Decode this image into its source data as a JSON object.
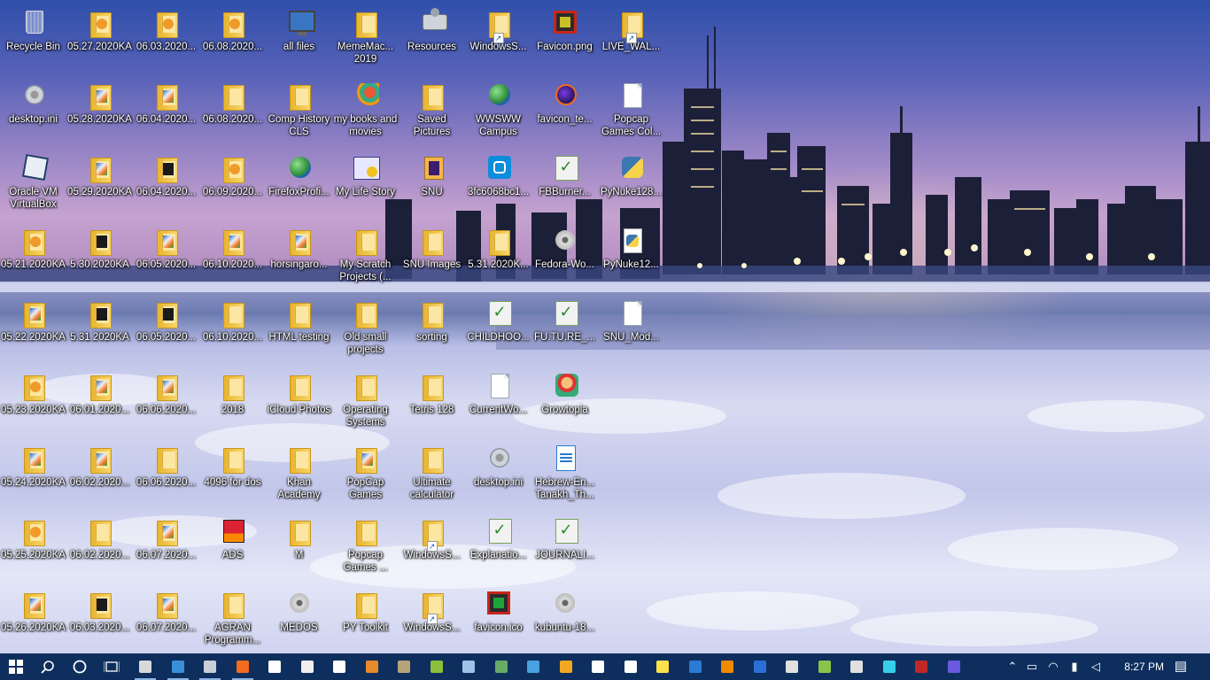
{
  "desktop_icons": [
    {
      "label": "Recycle Bin",
      "icon": "recycle-bin-icon",
      "col": 0,
      "row": 0
    },
    {
      "label": "desktop.ini",
      "icon": "settings-file-icon",
      "col": 0,
      "row": 1
    },
    {
      "label": "Oracle VM VirtualBox",
      "icon": "virtualbox-icon",
      "col": 0,
      "row": 2
    },
    {
      "label": "05.21.2020KA",
      "icon": "orange-folder-icon",
      "col": 0,
      "row": 3
    },
    {
      "label": "05.22.2020KA",
      "icon": "cover-folder-icon",
      "col": 0,
      "row": 4
    },
    {
      "label": "05.23.2020KA",
      "icon": "orange-folder-icon",
      "col": 0,
      "row": 5
    },
    {
      "label": "05.24.2020KA",
      "icon": "cover-folder-icon",
      "col": 0,
      "row": 6
    },
    {
      "label": "05.25.2020KA",
      "icon": "orange-folder-icon",
      "col": 0,
      "row": 7
    },
    {
      "label": "05.26.2020KA",
      "icon": "cover-folder-icon",
      "col": 0,
      "row": 8
    },
    {
      "label": "05.27.2020KA",
      "icon": "orange-folder-icon",
      "col": 1,
      "row": 0
    },
    {
      "label": "05.28.2020KA",
      "icon": "cover-folder-icon",
      "col": 1,
      "row": 1
    },
    {
      "label": "05.29.2020KA",
      "icon": "cover-folder-icon",
      "col": 1,
      "row": 2
    },
    {
      "label": "5.30.2020KA",
      "icon": "dark-folder-icon",
      "col": 1,
      "row": 3
    },
    {
      "label": "5.31.2020KA",
      "icon": "dark-folder-icon",
      "col": 1,
      "row": 4
    },
    {
      "label": "06.01.2020...",
      "icon": "cover-folder-icon",
      "col": 1,
      "row": 5
    },
    {
      "label": "06.02.2020...",
      "icon": "cover-folder-icon",
      "col": 1,
      "row": 6
    },
    {
      "label": "06.02.2020...",
      "icon": "folder-icon",
      "col": 1,
      "row": 7
    },
    {
      "label": "06.03.2020...",
      "icon": "dark-folder-icon",
      "col": 1,
      "row": 8
    },
    {
      "label": "06.03.2020...",
      "icon": "orange-folder-icon",
      "col": 2,
      "row": 0
    },
    {
      "label": "06.04.2020...",
      "icon": "cover-folder-icon",
      "col": 2,
      "row": 1
    },
    {
      "label": "06.04.2020...",
      "icon": "dark-folder-icon",
      "col": 2,
      "row": 2
    },
    {
      "label": "06.05.2020...",
      "icon": "cover-folder-icon",
      "col": 2,
      "row": 3
    },
    {
      "label": "06.05.2020...",
      "icon": "dark-folder-icon",
      "col": 2,
      "row": 4
    },
    {
      "label": "06.06.2020...",
      "icon": "cover-folder-icon",
      "col": 2,
      "row": 5
    },
    {
      "label": "06.06.2020...",
      "icon": "folder-icon",
      "col": 2,
      "row": 6
    },
    {
      "label": "06.07.2020...",
      "icon": "cover-folder-icon",
      "col": 2,
      "row": 7
    },
    {
      "label": "06.07.2020...",
      "icon": "cover-folder-icon",
      "col": 2,
      "row": 8
    },
    {
      "label": "06.08.2020...",
      "icon": "orange-folder-icon",
      "col": 3,
      "row": 0
    },
    {
      "label": "06.08.2020...",
      "icon": "folder-icon",
      "col": 3,
      "row": 1
    },
    {
      "label": "06.09.2020...",
      "icon": "orange-folder-icon",
      "col": 3,
      "row": 2
    },
    {
      "label": "06.10.2020...",
      "icon": "cover-folder-icon",
      "col": 3,
      "row": 3
    },
    {
      "label": "06.10.2020...",
      "icon": "folder-icon",
      "col": 3,
      "row": 4
    },
    {
      "label": "2018",
      "icon": "folder-icon",
      "col": 3,
      "row": 5
    },
    {
      "label": "4096 for dos",
      "icon": "folder-icon",
      "col": 3,
      "row": 6
    },
    {
      "label": "ADS",
      "icon": "ads-app-icon",
      "col": 3,
      "row": 7
    },
    {
      "label": "AGRAN Programm...",
      "icon": "folder-icon",
      "col": 3,
      "row": 8
    },
    {
      "label": "all files",
      "icon": "monitor-icon",
      "col": 4,
      "row": 0
    },
    {
      "label": "Comp History CLS",
      "icon": "folder-icon",
      "col": 4,
      "row": 1
    },
    {
      "label": "FirefoxProfi...",
      "icon": "firefox-profile-icon",
      "col": 4,
      "row": 2
    },
    {
      "label": "horsingaro...",
      "icon": "cover-folder-icon",
      "col": 4,
      "row": 3
    },
    {
      "label": "HTML testing",
      "icon": "folder-icon",
      "col": 4,
      "row": 4
    },
    {
      "label": "iCloud Photos",
      "icon": "folder-icon",
      "col": 4,
      "row": 5
    },
    {
      "label": "Khan Academy",
      "icon": "folder-icon",
      "col": 4,
      "row": 6
    },
    {
      "label": "M",
      "icon": "folder-icon",
      "col": 4,
      "row": 7
    },
    {
      "label": "MEDOS",
      "icon": "disc-image-icon",
      "col": 4,
      "row": 8
    },
    {
      "label": "MemeMac... 2019",
      "icon": "folder-icon",
      "col": 5,
      "row": 0
    },
    {
      "label": "my books and movies",
      "icon": "bookmark-app-icon",
      "col": 5,
      "row": 1
    },
    {
      "label": "My Life Story",
      "icon": "my-life-story-icon",
      "col": 5,
      "row": 2
    },
    {
      "label": "My Scratch Projects (...",
      "icon": "folder-icon",
      "col": 5,
      "row": 3
    },
    {
      "label": "Old small projects",
      "icon": "folder-icon",
      "col": 5,
      "row": 4
    },
    {
      "label": "Operating Systems",
      "icon": "folder-icon",
      "col": 5,
      "row": 5
    },
    {
      "label": "PopCap Games",
      "icon": "cover-folder-icon",
      "col": 5,
      "row": 6
    },
    {
      "label": "Popcap Games ...",
      "icon": "folder-icon",
      "col": 5,
      "row": 7
    },
    {
      "label": "PY Toolkit",
      "icon": "folder-icon",
      "col": 5,
      "row": 8
    },
    {
      "label": "Resources",
      "icon": "resources-icon",
      "col": 6,
      "row": 0
    },
    {
      "label": "Saved Pictures",
      "icon": "folder-icon",
      "col": 6,
      "row": 1
    },
    {
      "label": "SNU",
      "icon": "snu-app-icon",
      "col": 6,
      "row": 2
    },
    {
      "label": "SNU Images",
      "icon": "folder-icon",
      "col": 6,
      "row": 3
    },
    {
      "label": "sorting",
      "icon": "folder-icon",
      "col": 6,
      "row": 4
    },
    {
      "label": "Tetris 128",
      "icon": "folder-icon",
      "col": 6,
      "row": 5
    },
    {
      "label": "Ultimate calculator",
      "icon": "folder-icon",
      "col": 6,
      "row": 6
    },
    {
      "label": "WindowsS...",
      "icon": "windows-app-icon",
      "col": 6,
      "row": 7
    },
    {
      "label": "WindowsS...",
      "icon": "windows-app-icon",
      "col": 6,
      "row": 8
    },
    {
      "label": "WindowsS...",
      "icon": "windows-app-icon",
      "col": 7,
      "row": 0
    },
    {
      "label": "WWSWW Campus",
      "icon": "globe-icon",
      "col": 7,
      "row": 1
    },
    {
      "label": "3fc6068bc1...",
      "icon": "instagram-icon",
      "col": 7,
      "row": 2
    },
    {
      "label": "5.31.2020K...",
      "icon": "zip-folder-icon",
      "col": 7,
      "row": 3
    },
    {
      "label": "CHILDHOO...",
      "icon": "notepadpp-file-icon",
      "col": 7,
      "row": 4
    },
    {
      "label": "CurrentWo...",
      "icon": "document-icon",
      "col": 7,
      "row": 5
    },
    {
      "label": "desktop.ini",
      "icon": "settings-file-icon",
      "col": 7,
      "row": 6
    },
    {
      "label": "Explanatio...",
      "icon": "notepadpp-file-icon",
      "col": 7,
      "row": 7
    },
    {
      "label": "favicon.ico",
      "icon": "favicon-ico-icon",
      "col": 7,
      "row": 8
    },
    {
      "label": "Favicon.png",
      "icon": "favicon-png-icon",
      "col": 8,
      "row": 0
    },
    {
      "label": "favicon_te...",
      "icon": "firefox-icon",
      "col": 8,
      "row": 1
    },
    {
      "label": "FBBurner...",
      "icon": "notepadpp-file-icon",
      "col": 8,
      "row": 2
    },
    {
      "label": "Fedora-Wo...",
      "icon": "disc-image-icon",
      "col": 8,
      "row": 3
    },
    {
      "label": "FU.TU.RE_...",
      "icon": "notepadpp-file-icon",
      "col": 8,
      "row": 4
    },
    {
      "label": "Growtopia",
      "icon": "growtopia-icon",
      "col": 8,
      "row": 5
    },
    {
      "label": "Hebrew-En... Tanakh_Th...",
      "icon": "writer-document-icon",
      "col": 8,
      "row": 6
    },
    {
      "label": "JOURNALI...",
      "icon": "notepadpp-file-icon",
      "col": 8,
      "row": 7
    },
    {
      "label": "kubuntu-18...",
      "icon": "disc-image-icon",
      "col": 8,
      "row": 8
    },
    {
      "label": "LIVE_WAL...",
      "icon": "shortcut-folder-icon",
      "col": 9,
      "row": 0
    },
    {
      "label": "Popcap Games Col...",
      "icon": "document-icon",
      "col": 9,
      "row": 1
    },
    {
      "label": "PyNuke128...",
      "icon": "python-icon",
      "col": 9,
      "row": 2
    },
    {
      "label": "PyNuke12...",
      "icon": "python-file-icon",
      "col": 9,
      "row": 3
    },
    {
      "label": "SNU_Mod...",
      "icon": "document-icon",
      "col": 9,
      "row": 4
    }
  ],
  "taskbar": {
    "start": "windows-start-icon",
    "search": "search-icon",
    "cortana": "cortana-circle-icon",
    "task_view": "task-view-icon",
    "pinned": [
      {
        "icon": "this-pc-icon",
        "color": "#d9d9d9"
      },
      {
        "icon": "file-explorer-icon",
        "color": "#3b8fd8"
      },
      {
        "icon": "cloud-drive-icon",
        "color": "#c9cfd6"
      },
      {
        "icon": "firefox-icon",
        "color": "#f26b1e"
      },
      {
        "icon": "text-document-icon",
        "color": "#ffffff"
      },
      {
        "icon": "tools-icon",
        "color": "#f0f0f0"
      },
      {
        "icon": "sync-app-icon",
        "color": "#ffffff"
      },
      {
        "icon": "archive-app-icon",
        "color": "#e88a2a"
      },
      {
        "icon": "gimp-icon",
        "color": "#b7a27a"
      },
      {
        "icon": "green-app-icon",
        "color": "#8cbf3a"
      },
      {
        "icon": "remote-desktop-icon",
        "color": "#9ec2e8"
      },
      {
        "icon": "network-app-icon",
        "color": "#66aa66"
      },
      {
        "icon": "control-panel-icon",
        "color": "#4aa0e0"
      },
      {
        "icon": "notes-app-icon",
        "color": "#f4a820"
      },
      {
        "icon": "7zip-icon",
        "color": "#ffffff"
      },
      {
        "icon": "settings-gear-icon",
        "color": "#ffffff"
      },
      {
        "icon": "sticky-notes-icon",
        "color": "#ffe24a"
      },
      {
        "icon": "audio-wave-icon",
        "color": "#2b7ad6"
      },
      {
        "icon": "vlc-icon",
        "color": "#f08a00"
      },
      {
        "icon": "word-app-icon",
        "color": "#2b6fd6"
      },
      {
        "icon": "3d-cube-icon",
        "color": "#e0e0e0"
      },
      {
        "icon": "notepadpp-icon",
        "color": "#8bc34a"
      },
      {
        "icon": "inkscape-icon",
        "color": "#e0e0e0"
      },
      {
        "icon": "gem-app-icon",
        "color": "#35d0e8"
      },
      {
        "icon": "security-app-icon",
        "color": "#c02828"
      },
      {
        "icon": "photo-app-icon",
        "color": "#6a5adf"
      }
    ],
    "tray": {
      "chevron": "chevron-up-icon",
      "icons": [
        "tablet-icon",
        "wifi-icon",
        "battery-icon",
        "volume-icon"
      ],
      "time": "8:27 PM",
      "notifications": "action-center-icon"
    }
  }
}
